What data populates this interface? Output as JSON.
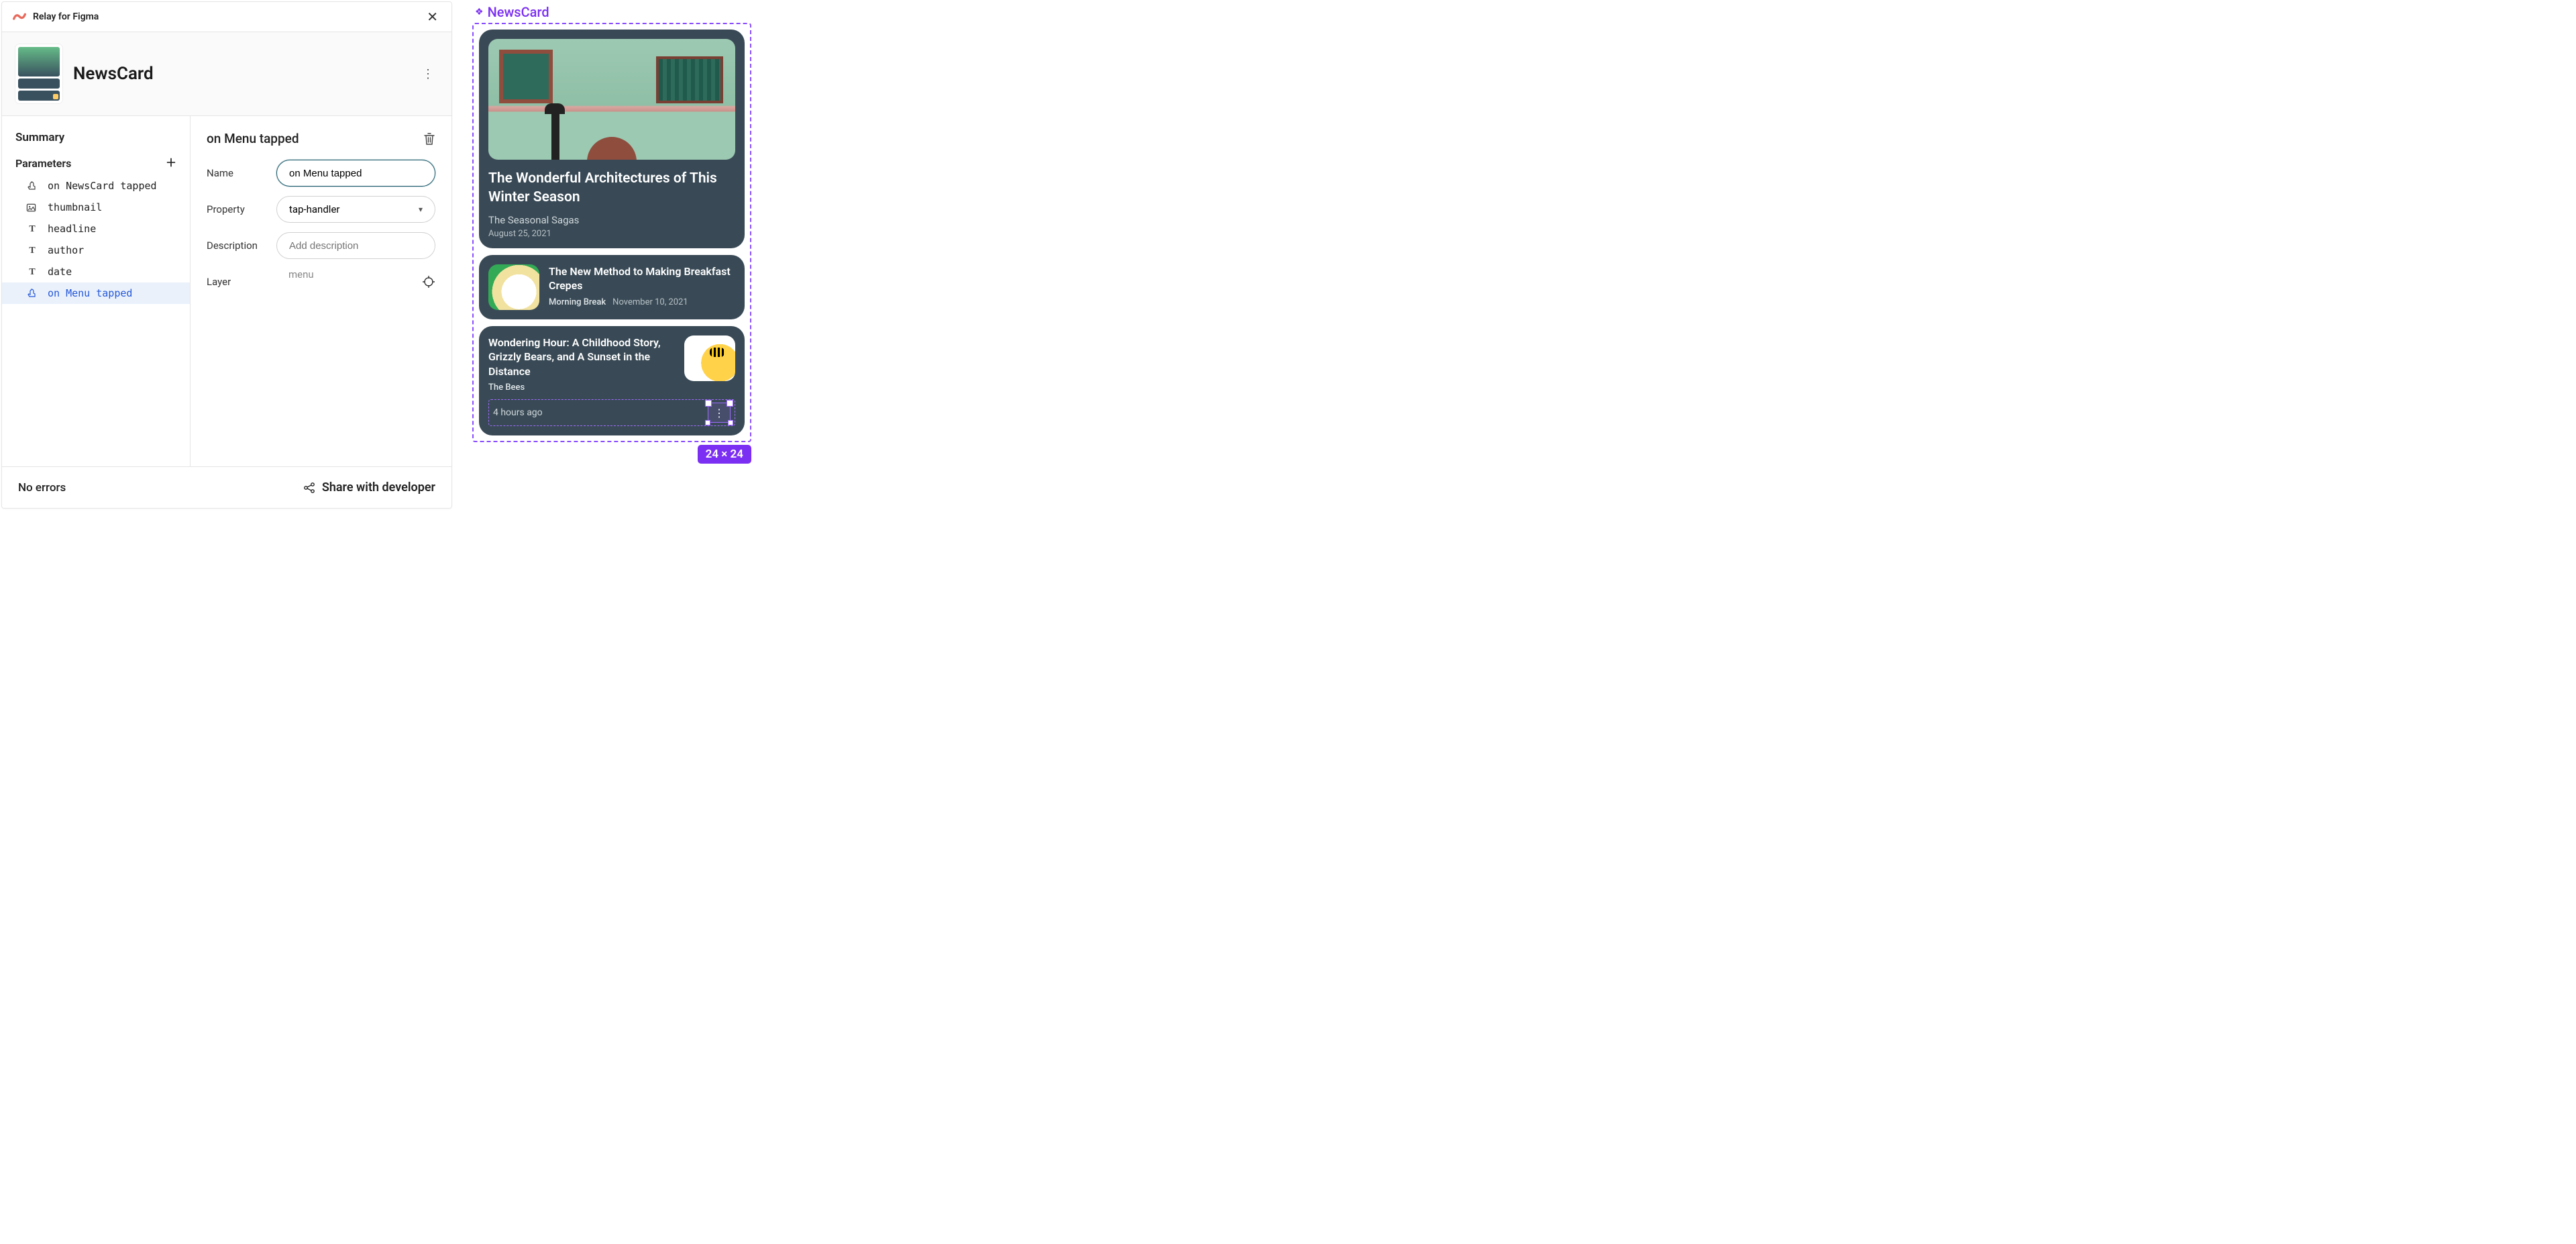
{
  "plugin": {
    "title": "Relay for Figma",
    "component_name": "NewsCard",
    "summary_label": "Summary",
    "parameters_label": "Parameters",
    "parameters": [
      {
        "icon": "tap",
        "name": "on NewsCard tapped"
      },
      {
        "icon": "image",
        "name": "thumbnail"
      },
      {
        "icon": "text",
        "name": "headline"
      },
      {
        "icon": "text",
        "name": "author"
      },
      {
        "icon": "text",
        "name": "date"
      },
      {
        "icon": "tap",
        "name": "on Menu tapped"
      }
    ],
    "selected_param_index": 5,
    "detail": {
      "title": "on Menu tapped",
      "fields": {
        "name_label": "Name",
        "name_value": "on Menu tapped",
        "property_label": "Property",
        "property_value": "tap-handler",
        "description_label": "Description",
        "description_placeholder": "Add description",
        "layer_label": "Layer",
        "layer_value": "menu"
      }
    },
    "footer": {
      "status": "No errors",
      "share_label": "Share with developer"
    }
  },
  "canvas": {
    "frame_name": "NewsCard",
    "selection_size": "24 × 24",
    "cards": {
      "hero": {
        "title": "The Wonderful Architectures of This Winter Season",
        "author": "The Seasonal Sagas",
        "date": "August 25, 2021"
      },
      "row1": {
        "title": "The New Method to Making Breakfast Crepes",
        "author": "Morning Break",
        "date": "November 10, 2021"
      },
      "row2": {
        "title": "Wondering Hour: A Childhood Story, Grizzly Bears, and A Sunset in the Distance",
        "author": "The Bees",
        "ago": "4 hours ago"
      }
    }
  }
}
